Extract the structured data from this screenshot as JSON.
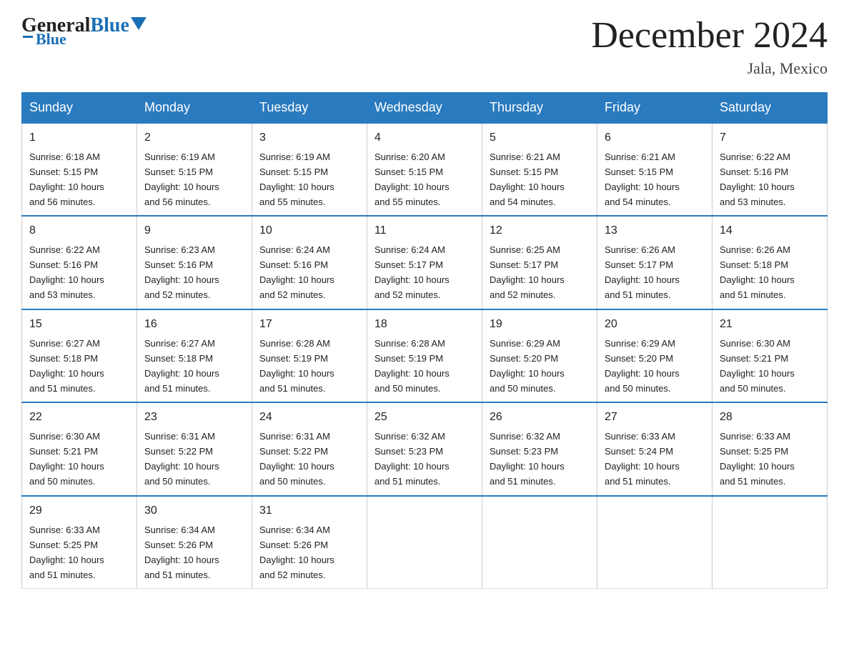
{
  "header": {
    "logo_general": "General",
    "logo_blue": "Blue",
    "month_title": "December 2024",
    "location": "Jala, Mexico"
  },
  "days_of_week": [
    "Sunday",
    "Monday",
    "Tuesday",
    "Wednesday",
    "Thursday",
    "Friday",
    "Saturday"
  ],
  "weeks": [
    [
      {
        "day": "1",
        "sunrise": "6:18 AM",
        "sunset": "5:15 PM",
        "daylight": "10 hours and 56 minutes."
      },
      {
        "day": "2",
        "sunrise": "6:19 AM",
        "sunset": "5:15 PM",
        "daylight": "10 hours and 56 minutes."
      },
      {
        "day": "3",
        "sunrise": "6:19 AM",
        "sunset": "5:15 PM",
        "daylight": "10 hours and 55 minutes."
      },
      {
        "day": "4",
        "sunrise": "6:20 AM",
        "sunset": "5:15 PM",
        "daylight": "10 hours and 55 minutes."
      },
      {
        "day": "5",
        "sunrise": "6:21 AM",
        "sunset": "5:15 PM",
        "daylight": "10 hours and 54 minutes."
      },
      {
        "day": "6",
        "sunrise": "6:21 AM",
        "sunset": "5:15 PM",
        "daylight": "10 hours and 54 minutes."
      },
      {
        "day": "7",
        "sunrise": "6:22 AM",
        "sunset": "5:16 PM",
        "daylight": "10 hours and 53 minutes."
      }
    ],
    [
      {
        "day": "8",
        "sunrise": "6:22 AM",
        "sunset": "5:16 PM",
        "daylight": "10 hours and 53 minutes."
      },
      {
        "day": "9",
        "sunrise": "6:23 AM",
        "sunset": "5:16 PM",
        "daylight": "10 hours and 52 minutes."
      },
      {
        "day": "10",
        "sunrise": "6:24 AM",
        "sunset": "5:16 PM",
        "daylight": "10 hours and 52 minutes."
      },
      {
        "day": "11",
        "sunrise": "6:24 AM",
        "sunset": "5:17 PM",
        "daylight": "10 hours and 52 minutes."
      },
      {
        "day": "12",
        "sunrise": "6:25 AM",
        "sunset": "5:17 PM",
        "daylight": "10 hours and 52 minutes."
      },
      {
        "day": "13",
        "sunrise": "6:26 AM",
        "sunset": "5:17 PM",
        "daylight": "10 hours and 51 minutes."
      },
      {
        "day": "14",
        "sunrise": "6:26 AM",
        "sunset": "5:18 PM",
        "daylight": "10 hours and 51 minutes."
      }
    ],
    [
      {
        "day": "15",
        "sunrise": "6:27 AM",
        "sunset": "5:18 PM",
        "daylight": "10 hours and 51 minutes."
      },
      {
        "day": "16",
        "sunrise": "6:27 AM",
        "sunset": "5:18 PM",
        "daylight": "10 hours and 51 minutes."
      },
      {
        "day": "17",
        "sunrise": "6:28 AM",
        "sunset": "5:19 PM",
        "daylight": "10 hours and 51 minutes."
      },
      {
        "day": "18",
        "sunrise": "6:28 AM",
        "sunset": "5:19 PM",
        "daylight": "10 hours and 50 minutes."
      },
      {
        "day": "19",
        "sunrise": "6:29 AM",
        "sunset": "5:20 PM",
        "daylight": "10 hours and 50 minutes."
      },
      {
        "day": "20",
        "sunrise": "6:29 AM",
        "sunset": "5:20 PM",
        "daylight": "10 hours and 50 minutes."
      },
      {
        "day": "21",
        "sunrise": "6:30 AM",
        "sunset": "5:21 PM",
        "daylight": "10 hours and 50 minutes."
      }
    ],
    [
      {
        "day": "22",
        "sunrise": "6:30 AM",
        "sunset": "5:21 PM",
        "daylight": "10 hours and 50 minutes."
      },
      {
        "day": "23",
        "sunrise": "6:31 AM",
        "sunset": "5:22 PM",
        "daylight": "10 hours and 50 minutes."
      },
      {
        "day": "24",
        "sunrise": "6:31 AM",
        "sunset": "5:22 PM",
        "daylight": "10 hours and 50 minutes."
      },
      {
        "day": "25",
        "sunrise": "6:32 AM",
        "sunset": "5:23 PM",
        "daylight": "10 hours and 51 minutes."
      },
      {
        "day": "26",
        "sunrise": "6:32 AM",
        "sunset": "5:23 PM",
        "daylight": "10 hours and 51 minutes."
      },
      {
        "day": "27",
        "sunrise": "6:33 AM",
        "sunset": "5:24 PM",
        "daylight": "10 hours and 51 minutes."
      },
      {
        "day": "28",
        "sunrise": "6:33 AM",
        "sunset": "5:25 PM",
        "daylight": "10 hours and 51 minutes."
      }
    ],
    [
      {
        "day": "29",
        "sunrise": "6:33 AM",
        "sunset": "5:25 PM",
        "daylight": "10 hours and 51 minutes."
      },
      {
        "day": "30",
        "sunrise": "6:34 AM",
        "sunset": "5:26 PM",
        "daylight": "10 hours and 51 minutes."
      },
      {
        "day": "31",
        "sunrise": "6:34 AM",
        "sunset": "5:26 PM",
        "daylight": "10 hours and 52 minutes."
      },
      null,
      null,
      null,
      null
    ]
  ],
  "labels": {
    "sunrise": "Sunrise:",
    "sunset": "Sunset:",
    "daylight": "Daylight:"
  }
}
